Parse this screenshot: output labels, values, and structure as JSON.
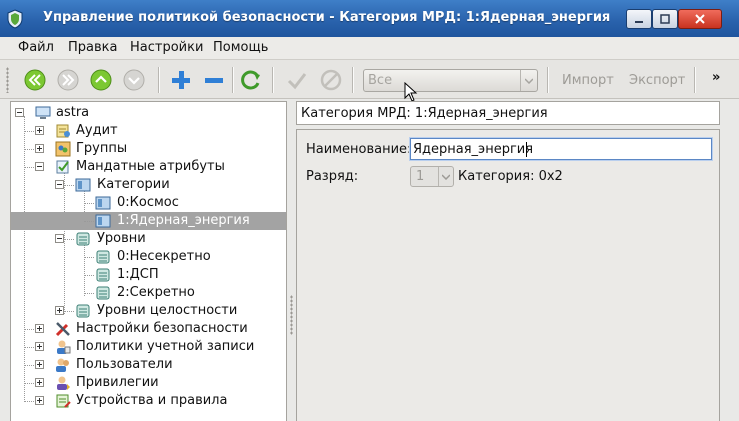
{
  "window": {
    "title": "Управление политикой безопасности - Категория МРД: 1:Ядерная_энергия"
  },
  "menu": {
    "items": [
      "Файл",
      "Правка",
      "Настройки",
      "Помощь"
    ]
  },
  "toolbar": {
    "filter_value": "Все",
    "import_label": "Импорт",
    "export_label": "Экспорт",
    "overflow_label": "»"
  },
  "tree": {
    "items": [
      {
        "label": "astra",
        "icon": "computer-icon"
      },
      {
        "label": "Аудит",
        "icon": "audit-icon"
      },
      {
        "label": "Группы",
        "icon": "groups-icon"
      },
      {
        "label": "Мандатные атрибуты",
        "icon": "mandatory-attributes-icon"
      },
      {
        "label": "Категории",
        "icon": "categories-icon"
      },
      {
        "label": "0:Космос",
        "icon": "category-icon"
      },
      {
        "label": "1:Ядерная_энергия",
        "icon": "category-icon",
        "selected": true
      },
      {
        "label": "Уровни",
        "icon": "levels-icon"
      },
      {
        "label": "0:Несекретно",
        "icon": "level-icon"
      },
      {
        "label": "1:ДСП",
        "icon": "level-icon"
      },
      {
        "label": "2:Секретно",
        "icon": "level-icon"
      },
      {
        "label": "Уровни целостности",
        "icon": "integrity-levels-icon"
      },
      {
        "label": "Настройки безопасности",
        "icon": "tools-icon"
      },
      {
        "label": "Политики учетной записи",
        "icon": "account-policy-icon"
      },
      {
        "label": "Пользователи",
        "icon": "users-icon"
      },
      {
        "label": "Привилегии",
        "icon": "privileges-icon"
      },
      {
        "label": "Устройства и правила",
        "icon": "devices-icon"
      }
    ]
  },
  "detail": {
    "path": "Категория МРД: 1:Ядерная_энергия",
    "name_label": "Наименование:",
    "name_value": "Ядерная_энергия",
    "bit_label": "Разряд:",
    "bit_value": "1",
    "category_hex": "Категория: 0x2"
  },
  "colors": {
    "titlebar": "#2a63ad",
    "selection": "#a3a3a3",
    "nav_green": "#6fbf2a",
    "add_blue": "#2f7fd6"
  }
}
